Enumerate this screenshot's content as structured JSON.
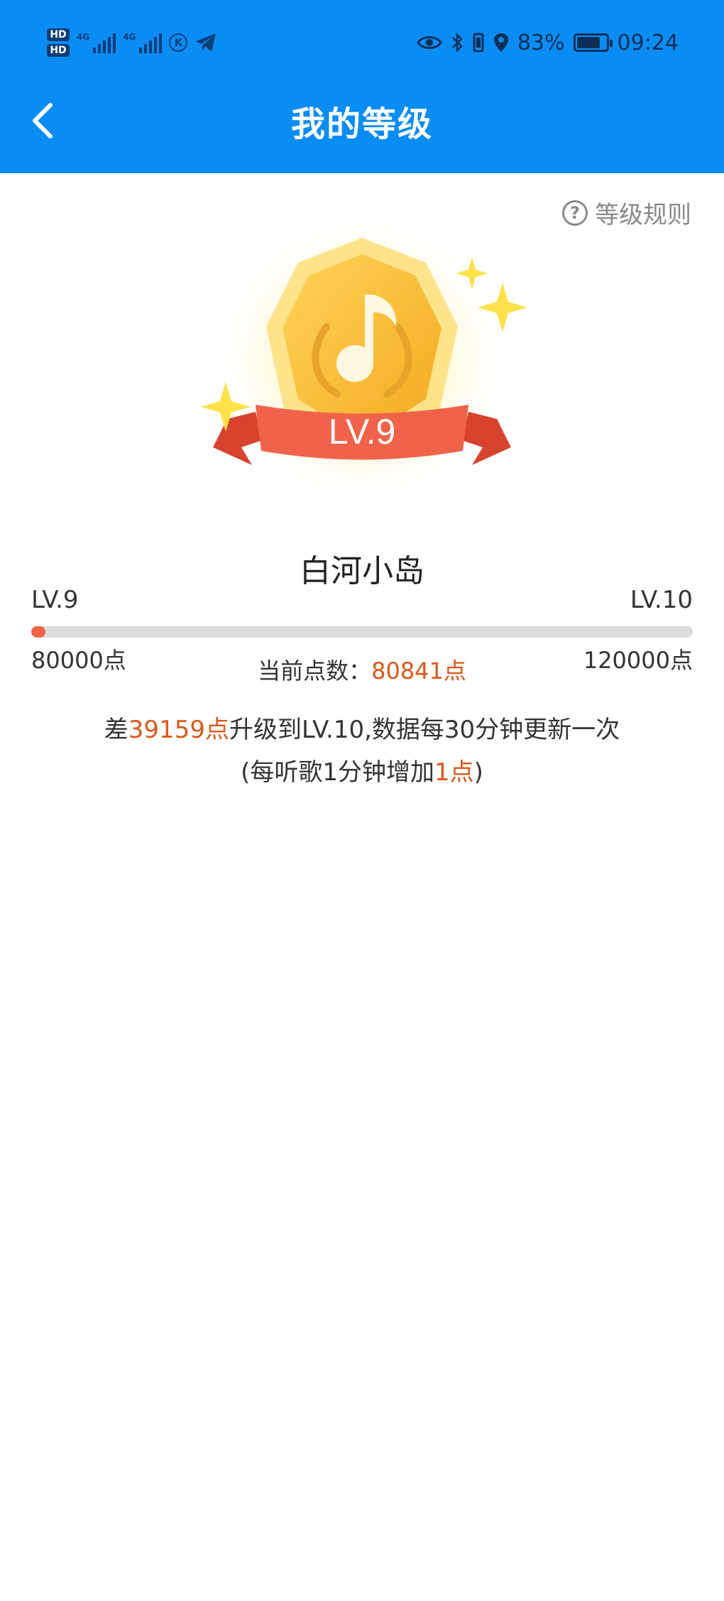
{
  "status_bar": {
    "hd1": "HD",
    "hd2": "HD",
    "net1": "4G",
    "net2": "4G",
    "k_label": "K",
    "battery_percent": "83%",
    "battery_level": 0.83,
    "time": "09:24"
  },
  "nav": {
    "title": "我的等级"
  },
  "rules": {
    "label": "等级规则"
  },
  "badge": {
    "level_text": "LV.9"
  },
  "user": {
    "name": "白河小岛"
  },
  "progress": {
    "current_level": "LV.9",
    "next_level": "LV.10",
    "min_points": "80000点",
    "max_points": "120000点",
    "fraction": 0.021,
    "current_label": "当前点数：",
    "current_value": "80841点"
  },
  "info": {
    "line1_prefix": "差",
    "line1_points": "39159点",
    "line1_suffix": "升级到LV.10,数据每30分钟更新一次",
    "line2_prefix": "(每听歌1分钟增加",
    "line2_points": "1点",
    "line2_suffix": ")"
  },
  "colors": {
    "header_bg": "#0a8cf5",
    "accent": "#d9581a",
    "progress_fill": "#f0634a",
    "progress_track": "#dcdcdc"
  }
}
